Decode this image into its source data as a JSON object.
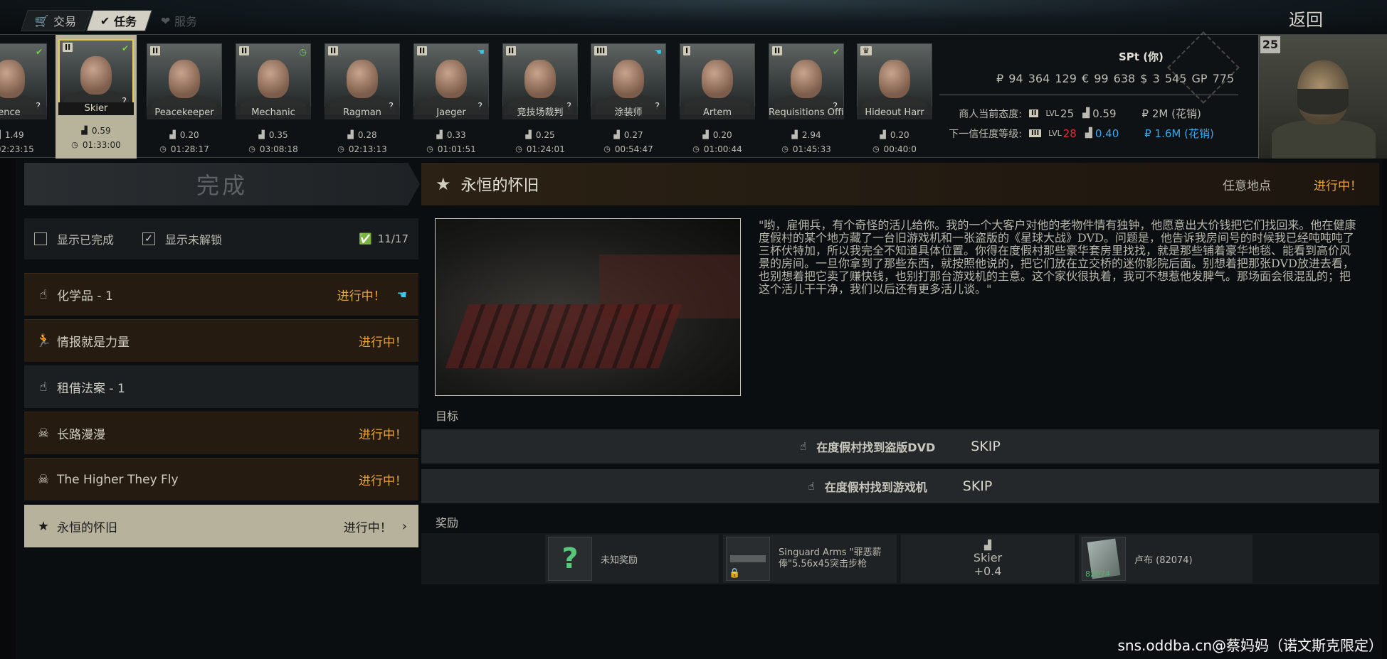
{
  "nav": {
    "tabs": [
      {
        "label": "交易",
        "icon": "cart-icon"
      },
      {
        "label": "任务",
        "icon": "check-icon"
      },
      {
        "label": "服务",
        "icon": "handshake-icon"
      }
    ],
    "back": "返回"
  },
  "traders": [
    {
      "name": "ence",
      "rank": "",
      "rep": "1.49",
      "time": "02:23:15",
      "status": "✔",
      "status_color": "#78d23c",
      "q": "?"
    },
    {
      "name": "Skier",
      "rank": "II",
      "rep": "0.59",
      "time": "01:33:00",
      "status": "✔",
      "status_color": "#78d23c",
      "q": "?"
    },
    {
      "name": "Peacekeeper",
      "rank": "II",
      "rep": "0.20",
      "time": "01:28:17",
      "status": "",
      "status_color": "#78d23c",
      "q": ""
    },
    {
      "name": "Mechanic",
      "rank": "II",
      "rep": "0.35",
      "time": "03:08:18",
      "status": "◷",
      "status_color": "#78d23c",
      "q": ""
    },
    {
      "name": "Ragman",
      "rank": "II",
      "rep": "0.28",
      "time": "02:13:13",
      "status": "",
      "status_color": "#78d23c",
      "q": "?"
    },
    {
      "name": "Jaeger",
      "rank": "II",
      "rep": "0.33",
      "time": "01:01:51",
      "status": "☚",
      "status_color": "#3ac8e8",
      "q": "?"
    },
    {
      "name": "竞技场裁判",
      "rank": "II",
      "rep": "0.25",
      "time": "01:24:01",
      "status": "",
      "status_color": "#78d23c",
      "q": "?"
    },
    {
      "name": "涂装师",
      "rank": "III",
      "rep": "0.27",
      "time": "00:54:47",
      "status": "☚",
      "status_color": "#3ac8e8",
      "q": "?"
    },
    {
      "name": "Artem",
      "rank": "I",
      "rep": "0.20",
      "time": "01:00:44",
      "status": "",
      "status_color": "#78d23c",
      "q": ""
    },
    {
      "name": "Requisitions Office",
      "rank": "II",
      "rep": "2.94",
      "time": "01:45:33",
      "status": "✔",
      "status_color": "#78d23c",
      "q": "?"
    },
    {
      "name": "Hideout Harr",
      "rank": "♛",
      "rep": "0.20",
      "time": "00:40:0",
      "status": "",
      "status_color": "#78d23c",
      "q": ""
    }
  ],
  "player": {
    "name": "SPt (你)",
    "money": "₽ 94 364 129  € 99 638  $ 3 545  GP 775",
    "current_label": "商人当前态度:",
    "current_rank": "II",
    "current_lvl_prefix": "LVL",
    "current_lvl": "25",
    "current_rep": "0.59",
    "current_sales": "₽ 2M (花销)",
    "next_label": "下一信任度等级:",
    "next_rank": "III",
    "next_lvl_prefix": "LVL",
    "next_lvl": "28",
    "next_rep": "0.40",
    "next_sales": "₽ 1.6M (花销)",
    "level": "25"
  },
  "sidebar": {
    "header": "完成",
    "show_completed": "显示已完成",
    "show_locked": "显示未解锁",
    "count": "11/17",
    "quests": [
      {
        "icon": "☝",
        "name": "化学品 - 1",
        "status": "进行中！",
        "style": "brown",
        "hand": "☚"
      },
      {
        "icon": "🏃",
        "name": "情报就是力量",
        "status": "进行中！",
        "style": "brown",
        "hand": ""
      },
      {
        "icon": "☝",
        "name": "租借法案 - 1",
        "status": "",
        "style": "gray",
        "hand": ""
      },
      {
        "icon": "☠",
        "name": "长路漫漫",
        "status": "进行中！",
        "style": "brown",
        "hand": ""
      },
      {
        "icon": "☠",
        "name": "The Higher They Fly",
        "status": "进行中！",
        "style": "brown",
        "hand": ""
      },
      {
        "icon": "★",
        "name": "永恒的怀旧",
        "status": "进行中！",
        "style": "sel",
        "hand": ""
      }
    ],
    "selected_arrow": "›"
  },
  "detail": {
    "title": "永恒的怀旧",
    "location": "任意地点",
    "status": "进行中！",
    "description": "\"哟，雇佣兵，有个奇怪的活儿给你。我的一个大客户对他的老物件情有独钟，他愿意出大价钱把它们找回来。他在健康度假村的某个地方藏了一台旧游戏机和一张盗版的《星球大战》DVD。问题是，他告诉我房间号的时候我已经吨吨吨了三杯伏特加，所以我完全不知道具体位置。你得在度假村那些豪华套房里找找，就是那些铺着豪华地毯、能看到高价风景的房间。一旦你拿到了那些东西，就按照他说的，把它们放在立交桥的迷你影院后面。别想着把那张DVD放进去看，也别想着把它卖了赚快钱，也别打那台游戏机的主意。这个家伙很执着，我可不想惹他发脾气。那场面会很混乱的；把这个活儿干干净，我们以后还有更多活儿谈。\"",
    "objectives_label": "目标",
    "objectives": [
      {
        "text": "在度假村找到盗版DVD",
        "skip": "SKIP"
      },
      {
        "text": "在度假村找到游戏机",
        "skip": "SKIP"
      }
    ],
    "rewards_label": "奖励",
    "rewards": {
      "unknown": "未知奖励",
      "weapon": "Singuard Arms \"罪恶薪俸\"5.56x45突击步枪",
      "rep_trader": "Skier",
      "rep_value": "+0.4",
      "money_label": "卢布 (82074)",
      "money_icon_text": "82074"
    }
  },
  "watermark": "sns.oddba.cn@蔡妈妈（诺文斯克限定）",
  "colors": {
    "accent_orange": "#e8a43c",
    "selected": "#b6b29c",
    "green": "#78d23c",
    "blue": "#3ac8e8"
  }
}
